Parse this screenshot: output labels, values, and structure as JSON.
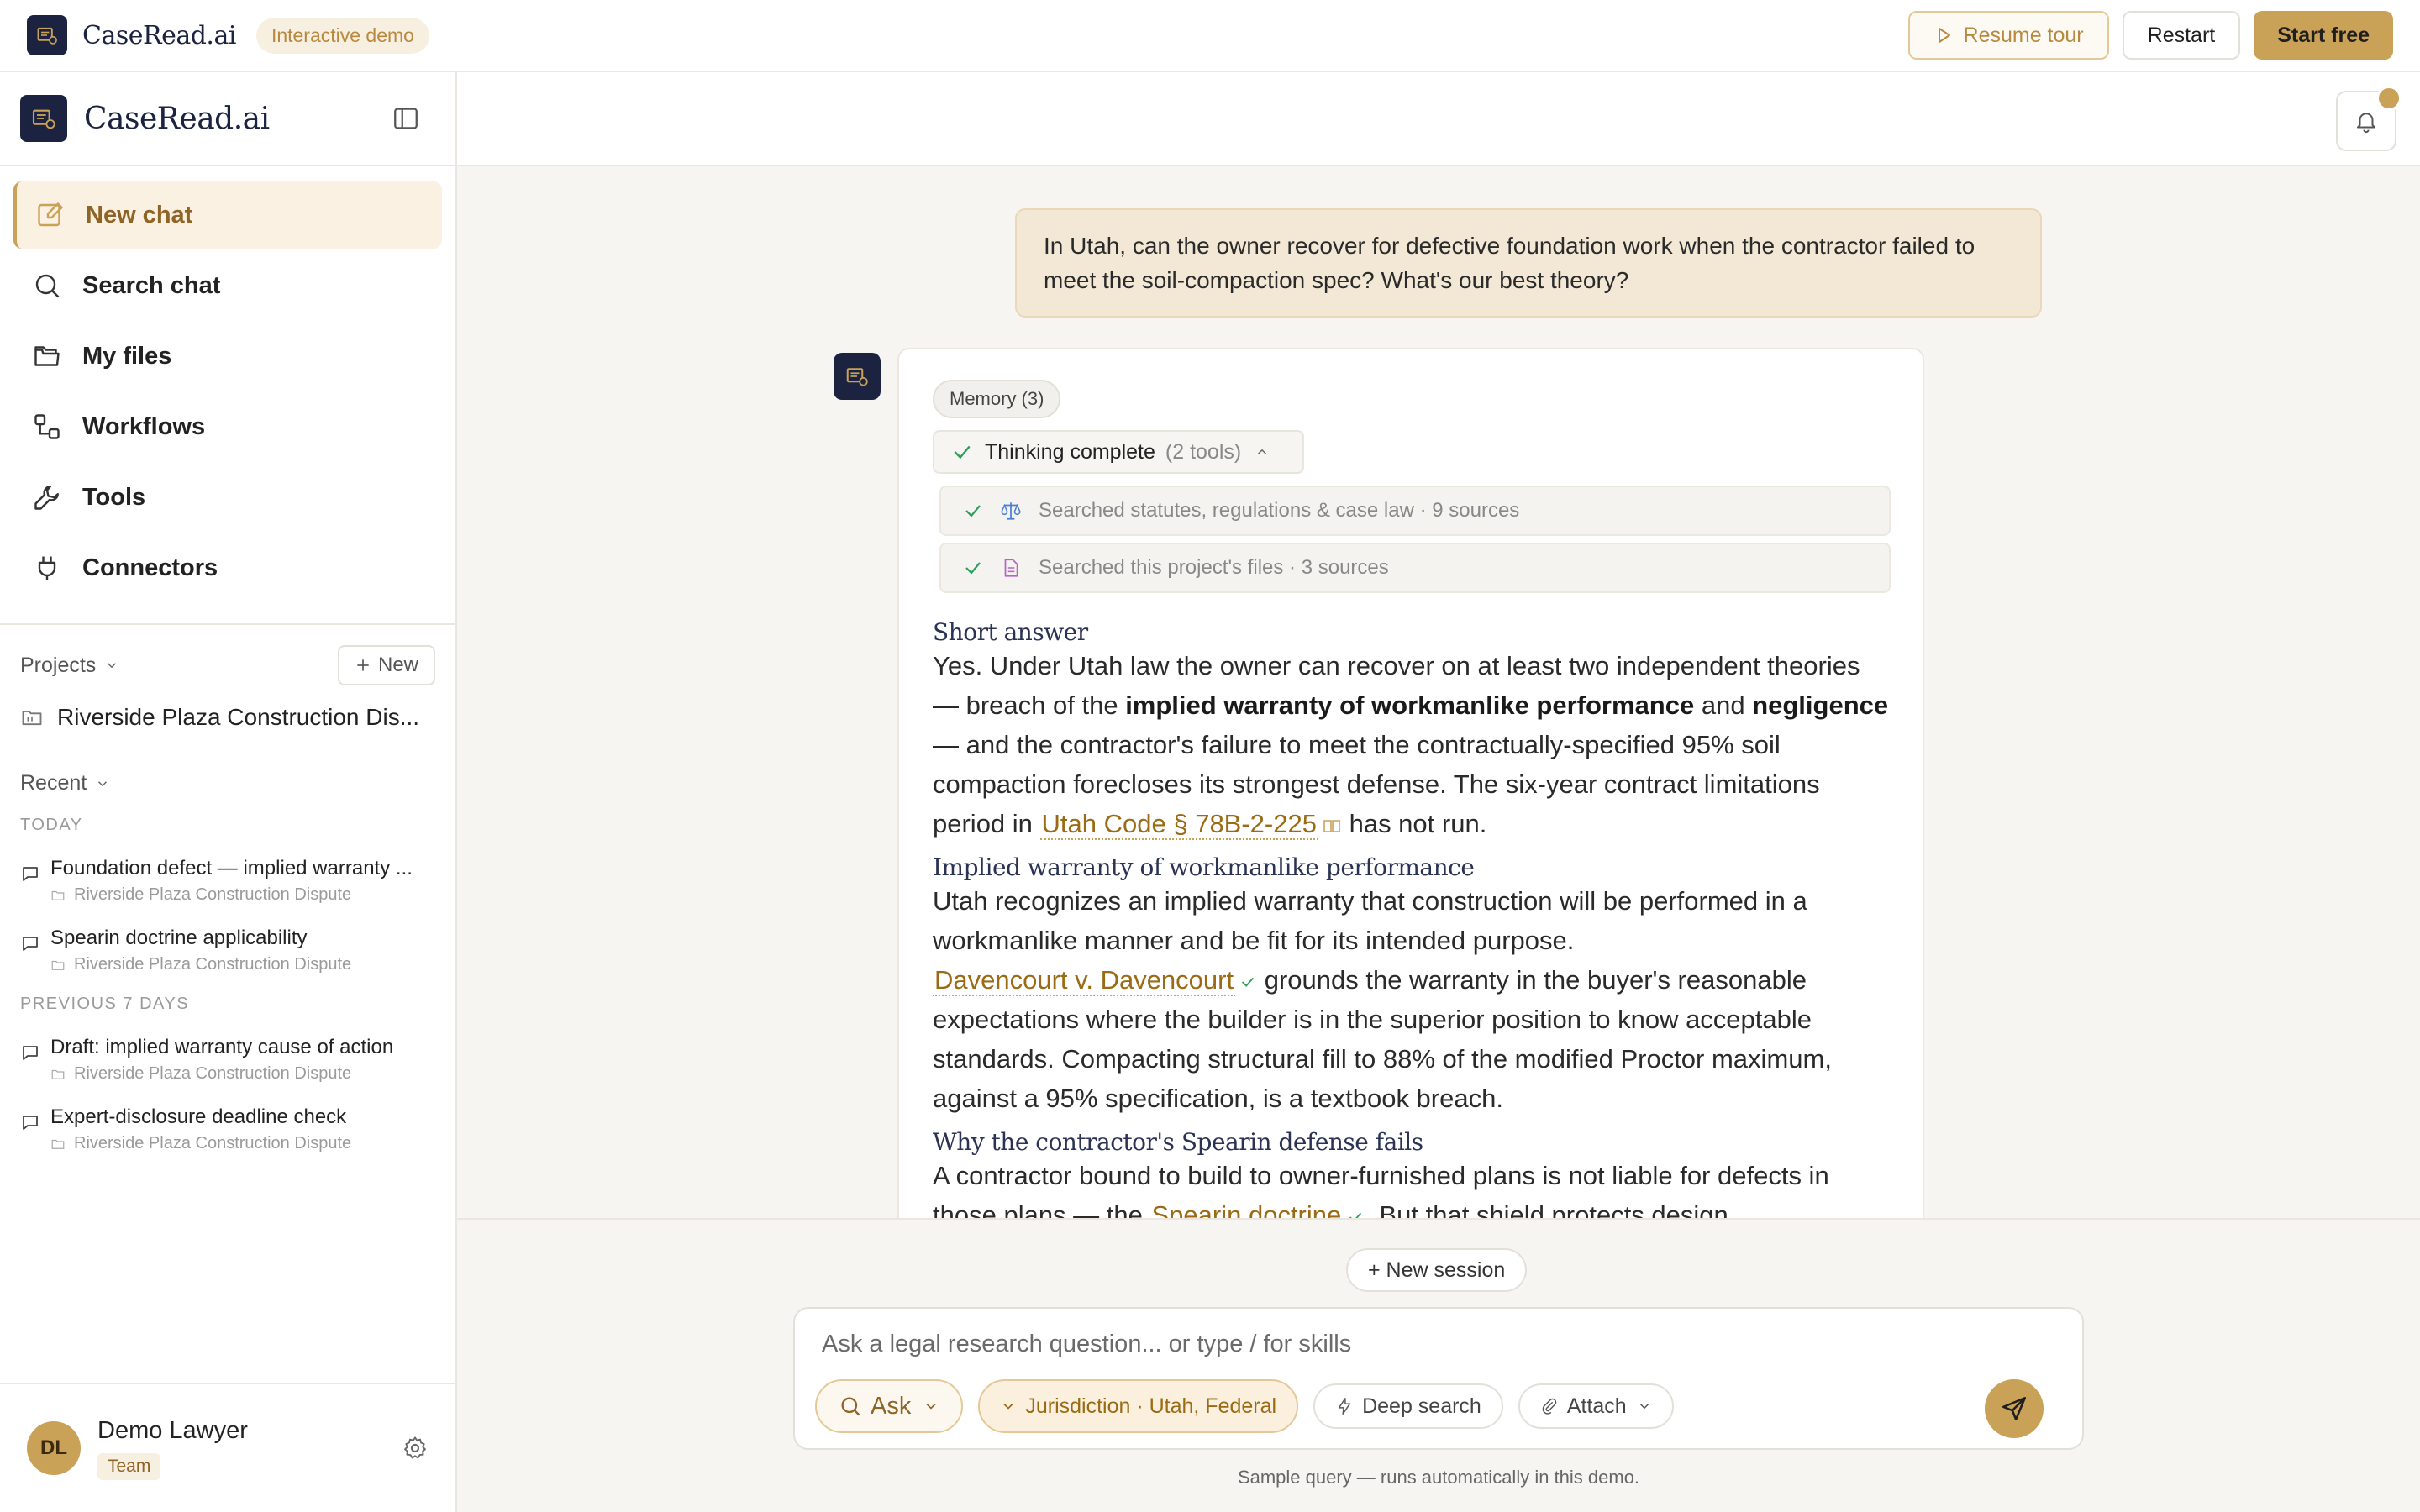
{
  "topbar": {
    "brand": "CaseRead.ai",
    "demo_badge": "Interactive demo",
    "resume_tour": "Resume tour",
    "restart": "Restart",
    "start_free": "Start free"
  },
  "sidebar": {
    "brand": "CaseRead.ai",
    "nav": [
      {
        "label": "New chat",
        "icon": "edit-icon"
      },
      {
        "label": "Search chat",
        "icon": "search-icon"
      },
      {
        "label": "My files",
        "icon": "folder-icon"
      },
      {
        "label": "Workflows",
        "icon": "workflow-icon"
      },
      {
        "label": "Tools",
        "icon": "wrench-icon"
      },
      {
        "label": "Connectors",
        "icon": "plug-icon"
      }
    ],
    "projects_label": "Projects",
    "new_label": "New",
    "project": "Riverside Plaza Construction Dis...",
    "recent_label": "Recent",
    "today_label": "TODAY",
    "prev_label": "PREVIOUS 7 DAYS",
    "recent": [
      {
        "title": "Foundation defect — implied warranty ...",
        "project": "Riverside Plaza Construction Dispute"
      },
      {
        "title": "Spearin doctrine applicability",
        "project": "Riverside Plaza Construction Dispute"
      },
      {
        "title": "Draft: implied warranty cause of action",
        "project": "Riverside Plaza Construction Dispute"
      },
      {
        "title": "Expert-disclosure deadline check",
        "project": "Riverside Plaza Construction Dispute"
      }
    ],
    "user": {
      "initials": "DL",
      "name": "Demo Lawyer",
      "team": "Team"
    }
  },
  "chat": {
    "user_message": "In Utah, can the owner recover for defective foundation work when the contractor failed to meet the soil-compaction spec? What's our best theory?",
    "memory": "Memory (3)",
    "thinking": "Thinking complete",
    "thinking_tools": "(2 tools)",
    "tools": [
      "Searched statutes, regulations & case law · 9 sources",
      "Searched this project's files · 3 sources"
    ],
    "h_short": "Short answer",
    "p1": {
      "a": "Yes. Under Utah law the owner can recover on at least two independent theories — breach of the ",
      "b": "implied warranty of workmanlike performance",
      "c": " and ",
      "d": "negligence",
      "e": " — and the contractor's failure to meet the contractually-specified 95% soil compaction forecloses its strongest defense. The six-year contract limitations period in ",
      "cite": "Utah Code § 78B-2-225",
      "f": " has not run."
    },
    "h_warranty": "Implied warranty of workmanlike performance",
    "p2": {
      "a": "Utah recognizes an implied warranty that construction will be performed in a workmanlike manner and be fit for its intended purpose.",
      "cite": "Davencourt v. Davencourt",
      "b": " grounds the warranty in the buyer's reasonable expectations where the builder is in the superior position to know acceptable standards. Compacting structural fill to 88% of the modified Proctor maximum, against a 95% specification, is a textbook breach."
    },
    "h_spearin": "Why the contractor's Spearin defense fails",
    "p3": {
      "a": "A contractor bound to build to owner-furnished plans is not liable for defects in those plans — the ",
      "cite": "Spearin doctrine",
      "b": ". But that shield protects design"
    }
  },
  "composer": {
    "new_session": "+ New session",
    "placeholder": "Ask a legal research question... or type / for skills",
    "ask": "Ask",
    "jurisdiction": "Jurisdiction · Utah, Federal",
    "deep_search": "Deep search",
    "attach": "Attach",
    "note": "Sample query — runs automatically in this demo."
  },
  "colors": {
    "accent": "#c9a157",
    "navy": "#1b2340",
    "active_bg": "#fbf1e2"
  }
}
